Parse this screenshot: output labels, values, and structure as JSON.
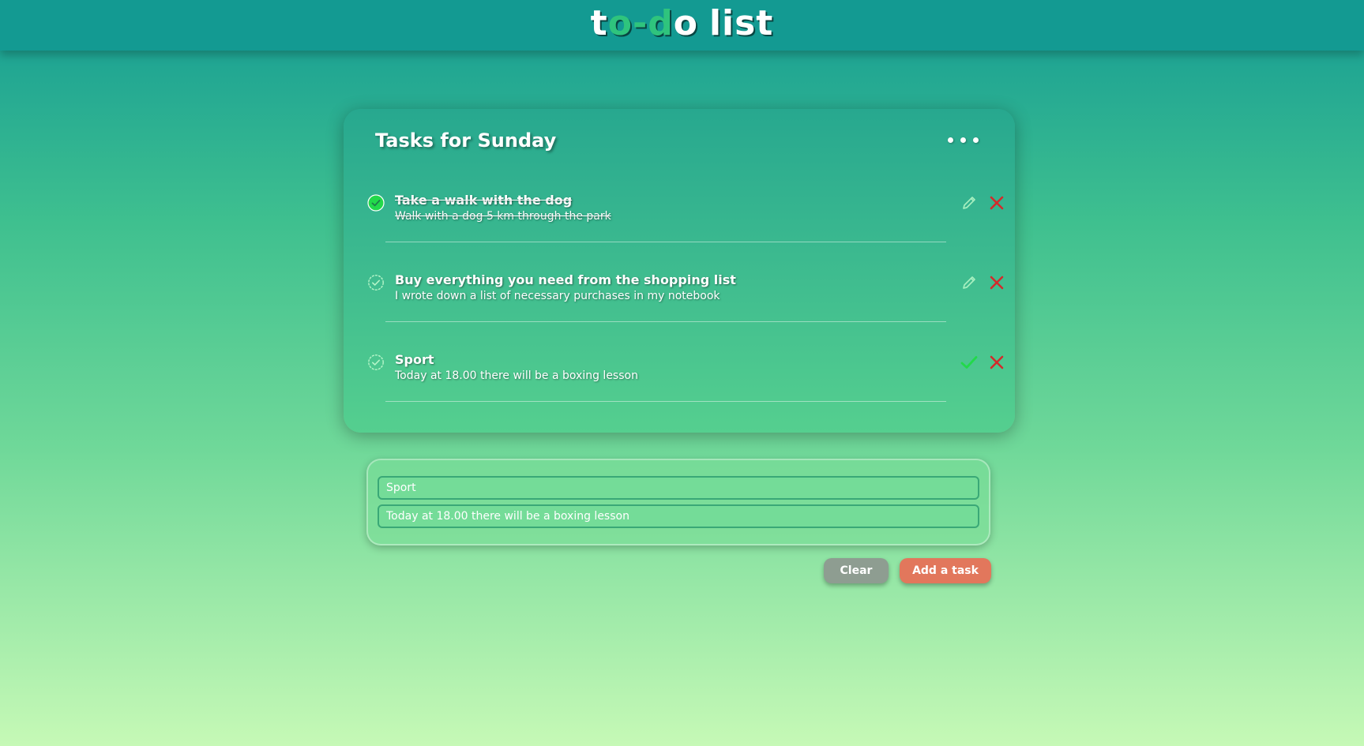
{
  "header": {
    "logo_parts": [
      {
        "text": "t",
        "color": "#ffffff"
      },
      {
        "text": "o",
        "color": "#2fc47d"
      },
      {
        "text": "-",
        "color": "#2fc47d"
      },
      {
        "text": "d",
        "color": "#2fc47d"
      },
      {
        "text": "o",
        "color": "#ffffff"
      },
      {
        "text": "list",
        "color": "#ffffff"
      }
    ]
  },
  "card": {
    "title": "Tasks for Sunday",
    "menu_icon": "more-horizontal-icon"
  },
  "tasks": [
    {
      "title": "Take a walk with the dog",
      "description": "Walk with a dog 5 km through the park",
      "completed": true,
      "primary_action_icon": "pencil-icon",
      "secondary_action_icon": "close-icon"
    },
    {
      "title": "Buy everything you need from the shopping list",
      "description": "I wrote down a list of necessary purchases in my notebook",
      "completed": false,
      "primary_action_icon": "pencil-icon",
      "secondary_action_icon": "close-icon"
    },
    {
      "title": "Sport",
      "description": "Today at 18.00 there will be a boxing lesson",
      "completed": false,
      "primary_action_icon": "checkmark-icon",
      "secondary_action_icon": "close-icon"
    }
  ],
  "form": {
    "title_value": "Sport",
    "description_value": "Today at 18.00 there will be a boxing lesson",
    "clear_label": "Clear",
    "add_label": "Add a task"
  },
  "colors": {
    "header_bg": "#139a92",
    "accent_green": "#2fc47d",
    "check_done": "#22d94a",
    "delete_red": "#d32b2b",
    "clear_button": "#8e9d91",
    "add_button": "#e2775c"
  }
}
